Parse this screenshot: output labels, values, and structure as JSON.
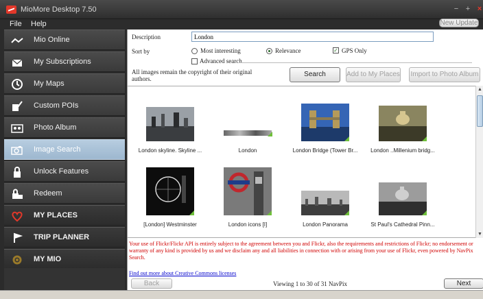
{
  "window": {
    "title": "MioMore Desktop 7.50"
  },
  "menu": {
    "file": "File",
    "help": "Help",
    "update_button": "New Update"
  },
  "sidebar": {
    "items": [
      {
        "label": "Mio Online"
      },
      {
        "label": "My Subscriptions"
      },
      {
        "label": "My Maps"
      },
      {
        "label": "Custom POIs"
      },
      {
        "label": "Photo Album"
      },
      {
        "label": "Image Search",
        "active": true
      },
      {
        "label": "Unlock Features"
      },
      {
        "label": "Redeem"
      },
      {
        "label": "MY PLACES"
      },
      {
        "label": "TRIP PLANNER"
      },
      {
        "label": "MY MIO"
      }
    ]
  },
  "search": {
    "description_label": "Description",
    "description_value": "London",
    "sort_label": "Sort by",
    "sort_options": {
      "most_interesting": "Most interesting",
      "relevance": "Relevance"
    },
    "sort_selected": "Relevance",
    "gps_only_label": "GPS Only",
    "gps_only_checked": true,
    "advanced_label": "Advanced search",
    "advanced_checked": false,
    "copyright_note": "All images remain the copyright of their original authors.",
    "search_button": "Search",
    "add_button": "Add to My Places",
    "import_button": "Import to Photo Album"
  },
  "results": {
    "items": [
      {
        "caption": "London skyline. Skyline ..."
      },
      {
        "caption": "London"
      },
      {
        "caption": "London Bridge (Tower Br..."
      },
      {
        "caption": "London ..Millenium bridg..."
      },
      {
        "caption": "[London] Westminster"
      },
      {
        "caption": "London icons [I]"
      },
      {
        "caption": "London Panorama"
      },
      {
        "caption": "St Paul's Cathedral Pinn..."
      }
    ]
  },
  "footer": {
    "disclaimer": "Your use of Flickr/Flickr API is entirely subject to the agreement between you and Flickr, also the requirements and restrictions of Flickr; no endorsement or warranty of any kind is provided by us and we disclaim any and all liabilities in connection with or arising from your use of Flickr, even powered by NavPix Search.",
    "cc_link": "Find out more about Creative Commons licenses",
    "back_button": "Back",
    "viewing_text": "Viewing 1 to 30 of 31 NavPix",
    "next_button": "Next"
  },
  "colors": {
    "accent_red": "#e2382a",
    "active_item": "#a9c1d8",
    "disclaimer": "#d00000",
    "badge_green": "#6fbf3a"
  }
}
